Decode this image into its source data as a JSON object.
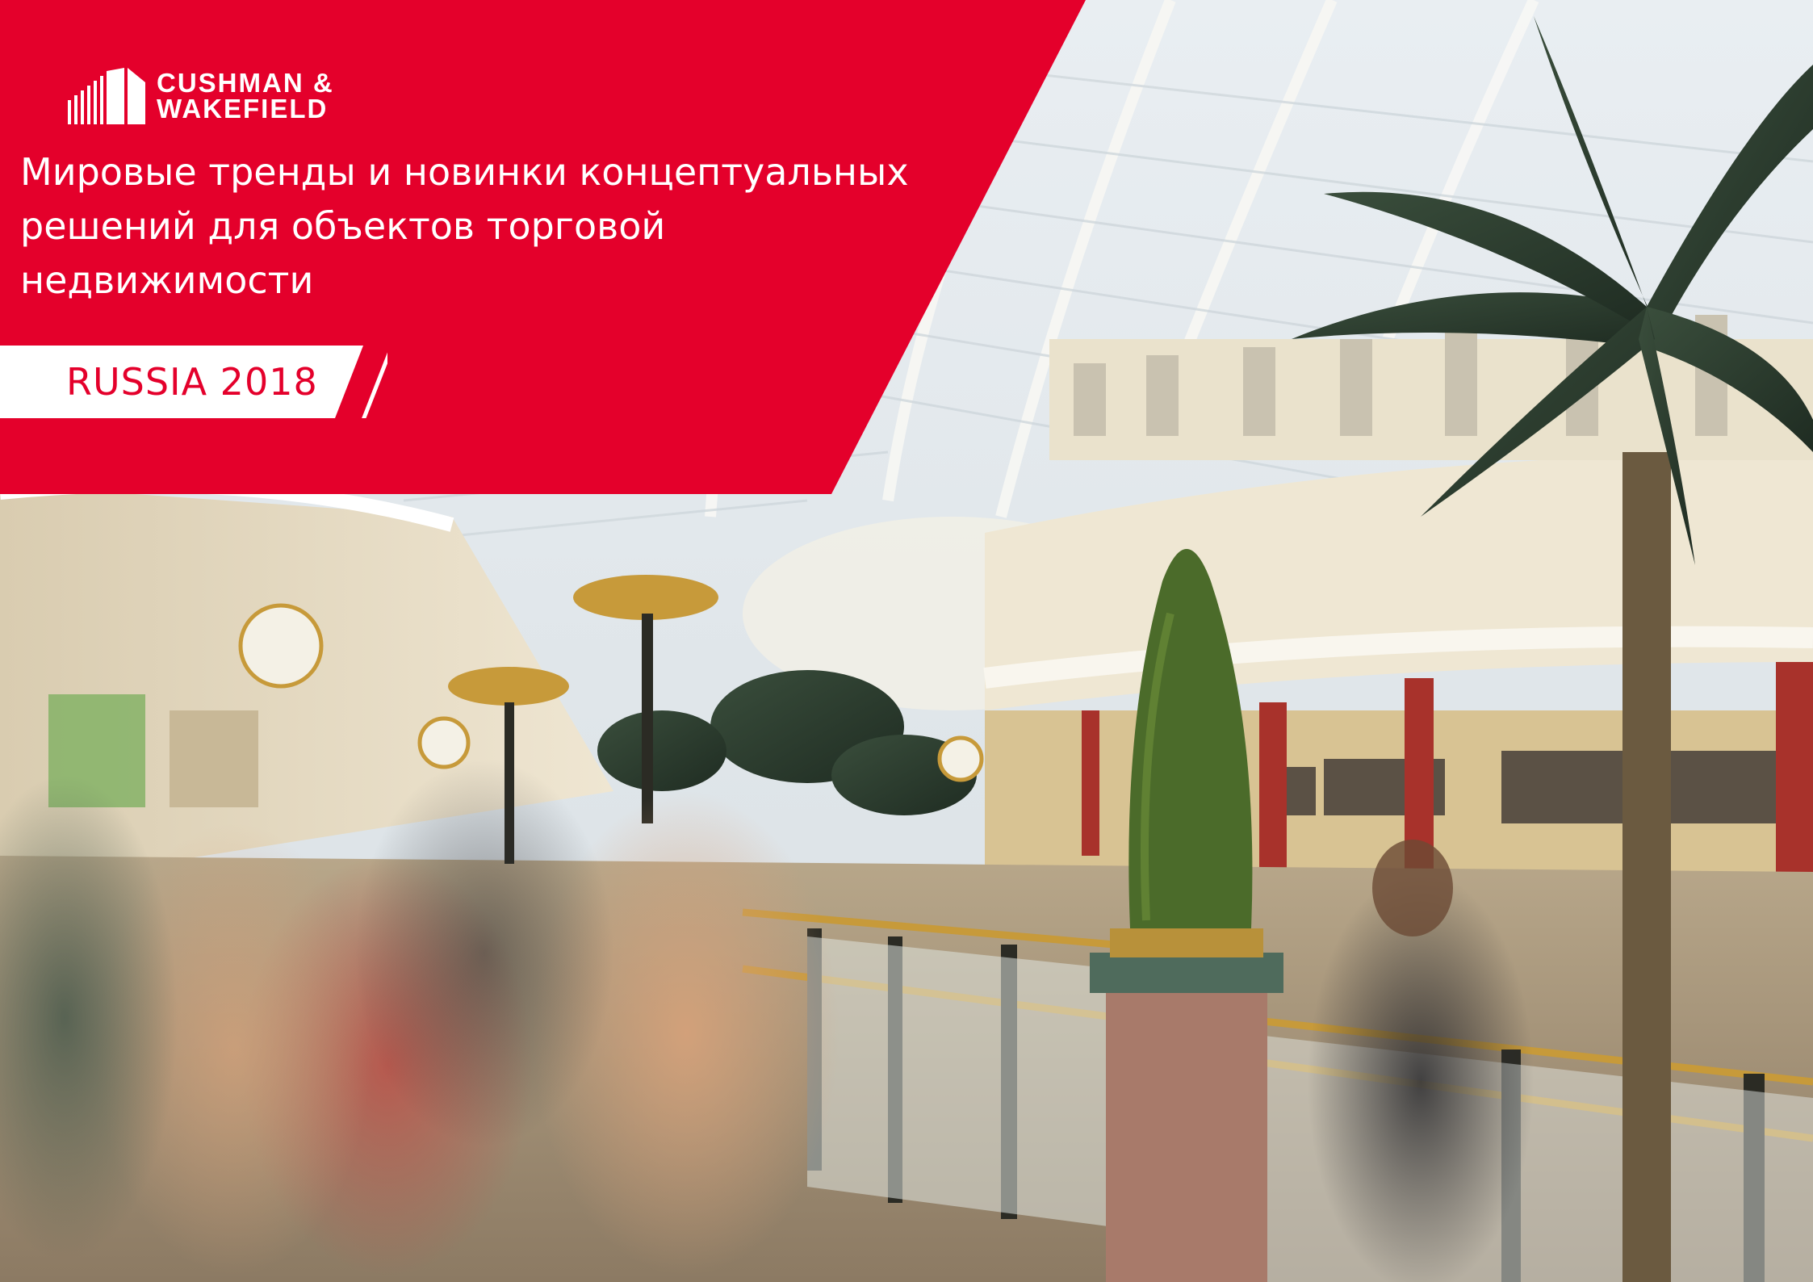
{
  "brand": {
    "name_line1": "CUSHMAN &",
    "name_line2": "WAKEFIELD",
    "color": "#e4002b"
  },
  "cover": {
    "title_lines": [
      "Мировые тренды и новинки концептуальных",
      "решений для объектов торговой",
      "недвижимости"
    ],
    "edition": "RUSSIA 2018"
  },
  "photo": {
    "subject": "shopping-mall-interior"
  }
}
